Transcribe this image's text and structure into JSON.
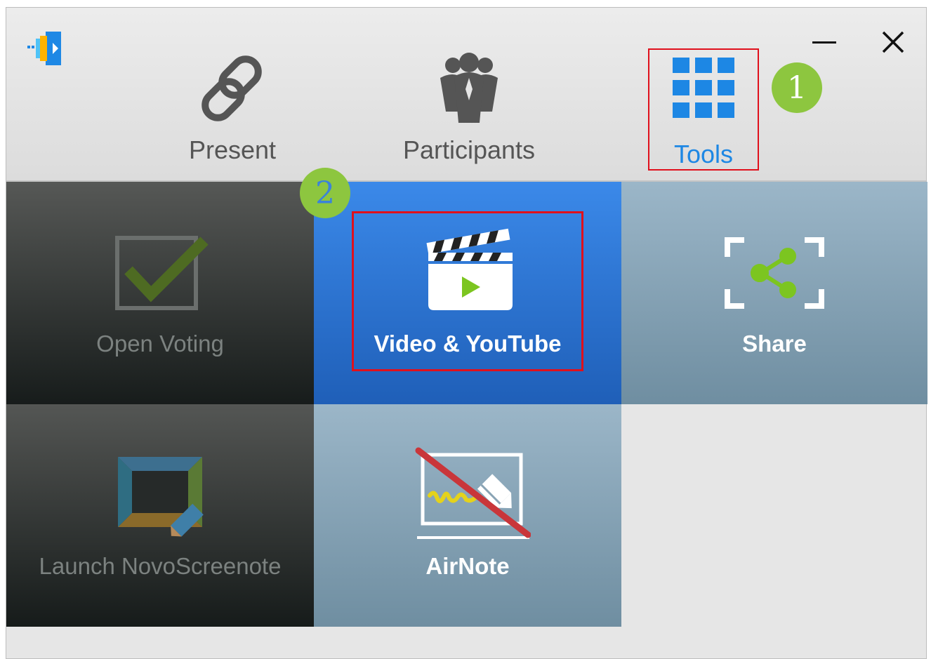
{
  "window": {
    "minimize_icon": "minimize-icon",
    "close_icon": "close-icon"
  },
  "app": {
    "logo_icon": "novo-app-logo"
  },
  "nav": {
    "tabs": [
      {
        "label": "Present",
        "icon": "link-icon",
        "selected": false
      },
      {
        "label": "Participants",
        "icon": "people-icon",
        "selected": false
      },
      {
        "label": "Tools",
        "icon": "grid-icon",
        "selected": true
      }
    ]
  },
  "annotations": {
    "step1": "1",
    "step2": "2",
    "badge_color": "#8dc63f",
    "highlight_color": "#e0101c"
  },
  "tools": [
    {
      "label": "Open Voting",
      "icon": "voting-checkbox-icon",
      "enabled": false
    },
    {
      "label": "Video & YouTube",
      "icon": "video-clapperboard-icon",
      "enabled": true,
      "selected": true
    },
    {
      "label": "Share",
      "icon": "share-icon",
      "enabled": true
    },
    {
      "label": "Launch NovoScreenote",
      "icon": "screenote-icon",
      "enabled": false
    },
    {
      "label": "AirNote",
      "icon": "airnote-disabled-icon",
      "enabled": true
    }
  ],
  "colors": {
    "accent": "#1d87e4",
    "selected_tile": "#2f79d8",
    "tile_blue_grey": "#87a3b6",
    "tile_dark": "#2c302f"
  }
}
